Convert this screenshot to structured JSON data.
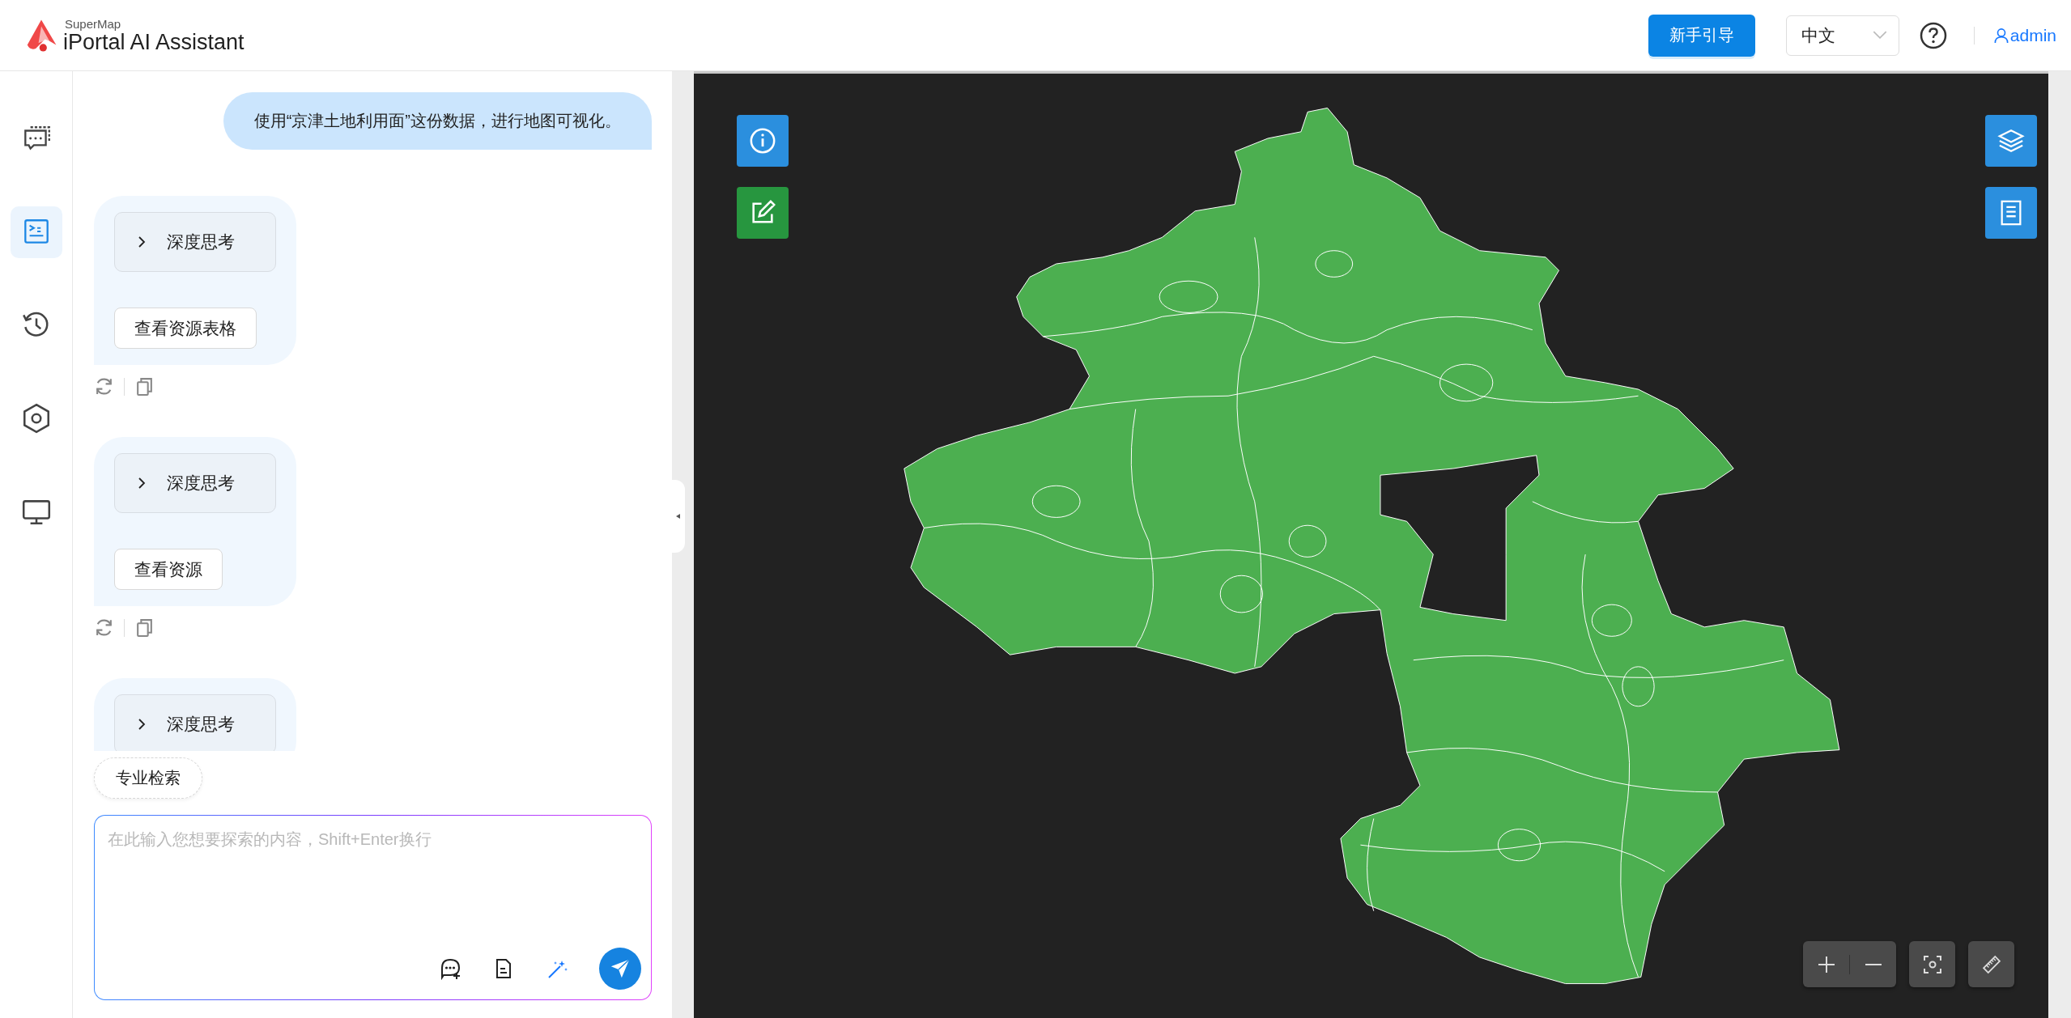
{
  "header": {
    "brand": "SuperMap",
    "title": "iPortal AI Assistant",
    "guide_button": "新手引导",
    "language": {
      "value": "中文"
    },
    "user": "admin"
  },
  "sidebar": {
    "items": [
      {
        "kind": "chat",
        "selected": false
      },
      {
        "kind": "terminal",
        "selected": true
      },
      {
        "kind": "history",
        "selected": false
      },
      {
        "kind": "settings",
        "selected": false
      },
      {
        "kind": "monitor",
        "selected": false
      }
    ]
  },
  "messages": [
    {
      "kind": "user",
      "text": "使用“京津土地利用面”这份数据，进行地图可视化。"
    },
    {
      "kind": "assistant",
      "thinking": {
        "label": "深度思考",
        "expanded": false
      },
      "action": "查看资源表格"
    },
    {
      "kind": "assistant",
      "thinking": {
        "label": "深度思考",
        "expanded": false
      },
      "action": "查看资源"
    },
    {
      "kind": "assistant",
      "thinking": {
        "label": "深度思考",
        "expanded": false
      }
    }
  ],
  "quick_chip": "专业检索",
  "input": {
    "placeholder": "在此输入您想要探索的内容，Shift+Enter换行"
  }
}
